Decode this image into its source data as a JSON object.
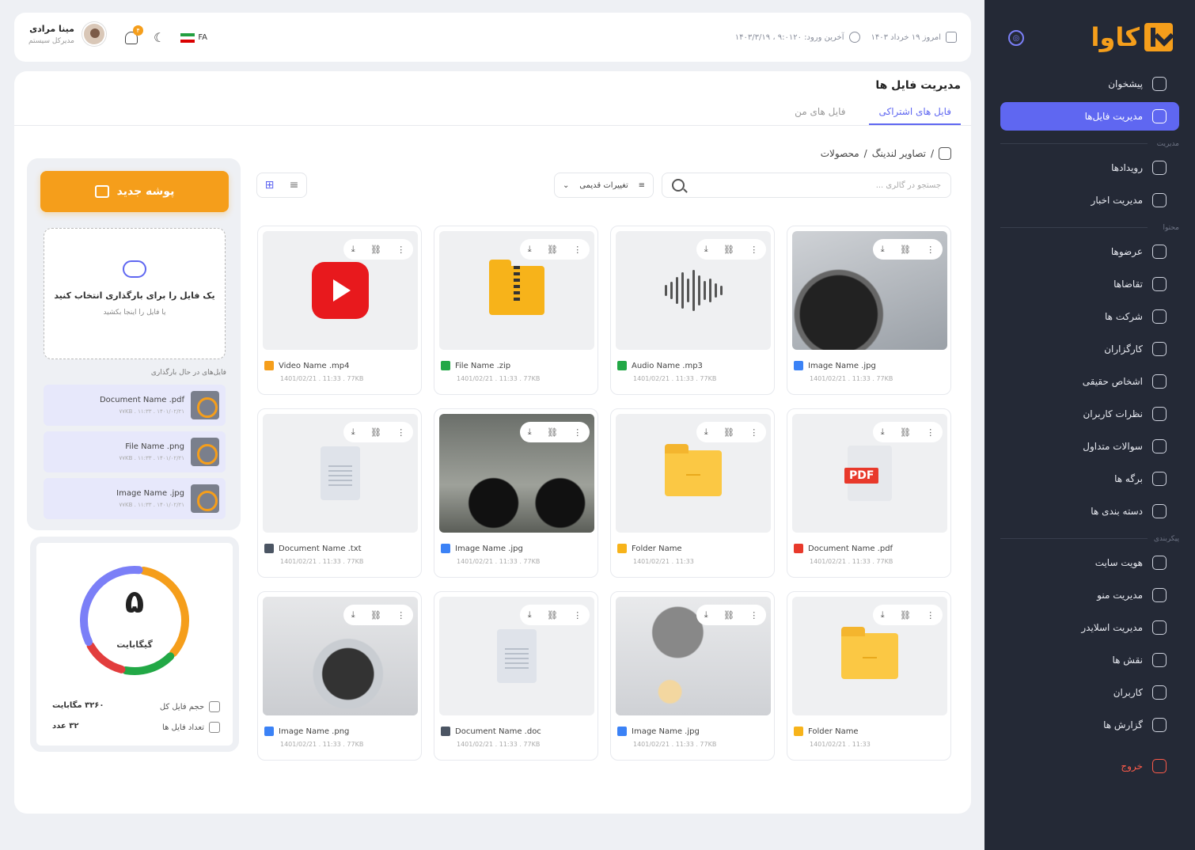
{
  "sidebar": {
    "logo": "کاوا",
    "items": [
      {
        "label": "پیشخوان"
      },
      {
        "label": "مدیریت فایل‌ها"
      },
      {
        "label": "رویدادها"
      },
      {
        "label": "مدیریت اخبار"
      },
      {
        "label": "عرضوها"
      },
      {
        "label": "تقاضاها"
      },
      {
        "label": "شرکت ها"
      },
      {
        "label": "کارگزاران"
      },
      {
        "label": "اشخاص حقیقی"
      },
      {
        "label": "نظرات کاربران"
      },
      {
        "label": "سوالات متداول"
      },
      {
        "label": "برگه ها"
      },
      {
        "label": "دسته بندی ها"
      },
      {
        "label": "هویت سایت"
      },
      {
        "label": "مدیریت منو"
      },
      {
        "label": "مدیریت اسلایدر"
      },
      {
        "label": "نقش ها"
      },
      {
        "label": "کاربران"
      },
      {
        "label": "گزارش ها"
      },
      {
        "label": "خروج"
      }
    ],
    "sections": {
      "manage": "مدیریت",
      "content": "محتوا",
      "config": "پیکربندی"
    }
  },
  "topbar": {
    "user_name": "مینا مرادی",
    "user_role": "مدیرکل سیستم",
    "notif_count": "۴",
    "lang": "FA",
    "today": "امروز ۱۹ خرداد ۱۴۰۳",
    "last_login": "آخرین ورود: ۹:۰۱۲۰ ، ۱۴۰۳/۳/۱۹"
  },
  "page": {
    "title": "مدیریت فایل ها",
    "tabs": [
      "فایل های اشتراکی",
      "فایل های من"
    ],
    "breadcrumb": [
      "/",
      "تصاویر لندینگ",
      "/",
      "محصولات"
    ],
    "search_placeholder": "جستجو در گالری ...",
    "sort_label": "تغییرات قدیمی"
  },
  "left": {
    "new_folder": "پوشه جدید",
    "dz_title": "یک فایل را برای بارگذاری انتخاب کنید",
    "dz_sub": "یا فایل را اینجا بکشید",
    "uploading_title": "فایل‌های در حال بارگذاری",
    "uploads": [
      {
        "name": "Document Name .pdf",
        "meta": "۱۴۰۱/۰۲/۲۱ . ۱۱:۳۳ . ۷۷KB"
      },
      {
        "name": "File Name .png",
        "meta": "۱۴۰۱/۰۲/۲۱ . ۱۱:۳۳ . ۷۷KB"
      },
      {
        "name": "Image Name .jpg",
        "meta": "۱۴۰۱/۰۲/۲۱ . ۱۱:۳۳ . ۷۷KB"
      }
    ]
  },
  "storage": {
    "amount": "۵",
    "unit": "گیگابایت",
    "rows": [
      {
        "label": "حجم فایل کل",
        "value": "۳۲۶۰ مگابایت"
      },
      {
        "label": "تعداد فایل ها",
        "value": "۳۲ عدد"
      }
    ],
    "ring_colors": [
      "#f59e1b",
      "#22a846",
      "#e23d3d",
      "#7b7ff7"
    ]
  },
  "files": [
    {
      "name": "Video Name .mp4",
      "meta": "1401/02/21 . 11:33 . 77KB",
      "kind": "video",
      "icon": "youtube-icon"
    },
    {
      "name": "File Name .zip",
      "meta": "1401/02/21 . 11:33 . 77KB",
      "kind": "zip",
      "icon": "zip-folder-icon"
    },
    {
      "name": "Audio Name .mp3",
      "meta": "1401/02/21 . 11:33 . 77KB",
      "kind": "audio",
      "icon": "waveform-icon"
    },
    {
      "name": "Image Name .jpg",
      "meta": "1401/02/21 . 11:33 . 77KB",
      "kind": "image",
      "icon": "image-scooter"
    },
    {
      "name": "Document Name .txt",
      "meta": "1401/02/21 . 11:33 . 77KB",
      "kind": "doc",
      "icon": "document-icon"
    },
    {
      "name": "Image Name .jpg",
      "meta": "1401/02/21 . 11:33 . 77KB",
      "kind": "image",
      "icon": "image-motorbike"
    },
    {
      "name": "Folder Name",
      "meta": "1401/02/21 . 11:33",
      "kind": "folder",
      "icon": "folder-icon"
    },
    {
      "name": "Document Name .pdf",
      "meta": "1401/02/21 . 11:33 . 77KB",
      "kind": "pdf",
      "icon": "pdf-icon"
    },
    {
      "name": "Image Name .png",
      "meta": "1401/02/21 . 11:33 . 77KB",
      "kind": "image",
      "icon": "image-hose"
    },
    {
      "name": "Document Name .doc",
      "meta": "1401/02/21 . 11:33 . 77KB",
      "kind": "doc",
      "icon": "document-icon"
    },
    {
      "name": "Image Name .jpg",
      "meta": "1401/02/21 . 11:33 . 77KB",
      "kind": "image",
      "icon": "image-handle"
    },
    {
      "name": "Folder Name",
      "meta": "1401/02/21 . 11:33",
      "kind": "folder",
      "icon": "folder-icon"
    }
  ]
}
